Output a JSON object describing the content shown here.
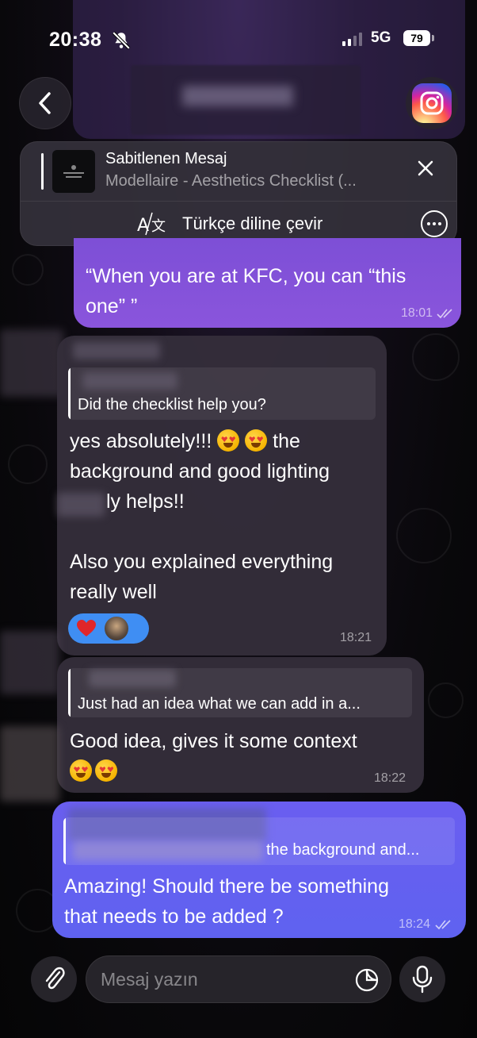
{
  "status_bar": {
    "time": "20:38",
    "network": "5G",
    "battery": "79"
  },
  "header": {
    "contact_name": ""
  },
  "pinned": {
    "title": "Sabitlenen Mesaj",
    "subtitle": "Modellaire - Aesthetics Checklist (...",
    "translate_label": "Türkçe diline çevir"
  },
  "messages": [
    {
      "direction": "out",
      "text_line1": "“When you are at KFC, you can “this",
      "text_line2": "one” ”",
      "time": "18:01"
    },
    {
      "direction": "in",
      "reply_text": "Did the checklist help you?",
      "text_line1": "yes absolutely!!!",
      "text_line1_after": "the",
      "text_line2": "background and good lighting",
      "text_line3": "ly helps!!",
      "text_line4": "Also you explained everything",
      "text_line5": "really well",
      "time": "18:21"
    },
    {
      "direction": "in",
      "reply_text": "Just had an idea what we can add in a...",
      "text_line1": "Good idea, gives it some context",
      "time": "18:22"
    },
    {
      "direction": "out",
      "reply_text": "the background and...",
      "text_line1": "Amazing! Should there be something",
      "text_line2": "that needs to be added ?",
      "time": "18:24"
    }
  ],
  "input": {
    "placeholder": "Mesaj yazın"
  },
  "colors": {
    "out_purple": "#8a55dc",
    "out_blue": "#6a5ef0",
    "incoming": "#342e3a",
    "reaction": "#3f8ef3"
  }
}
